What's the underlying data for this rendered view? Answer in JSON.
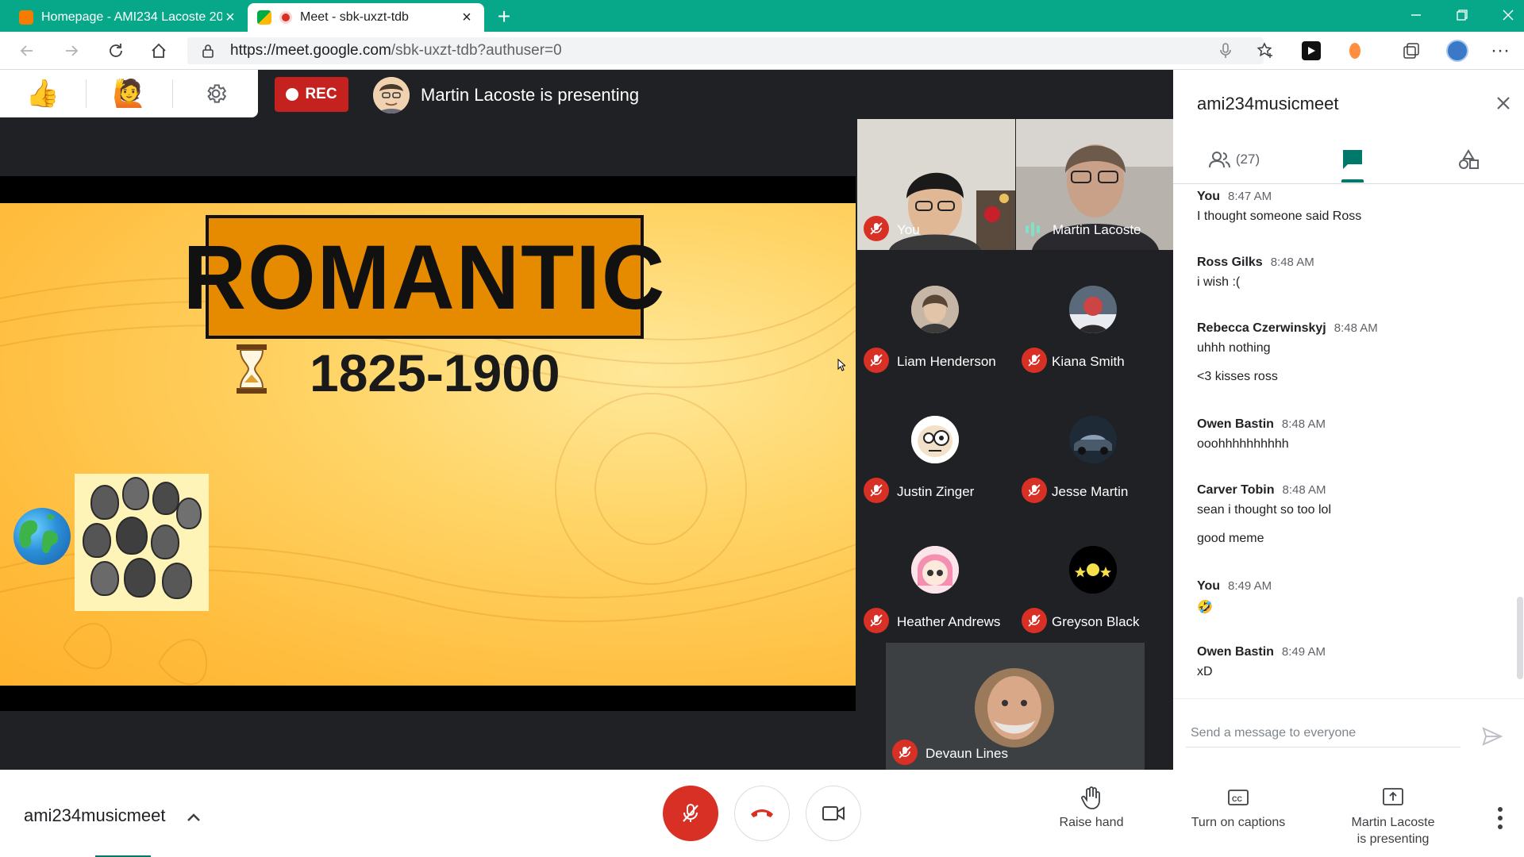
{
  "browser": {
    "tabs": [
      {
        "title": "Homepage - AMI234 Lacoste 20",
        "active": false,
        "favicon_color": "#f57c00"
      },
      {
        "title": "Meet - sbk-uxzt-tdb",
        "active": true,
        "favicon_color": "#00ac47",
        "recording_dot_color": "#d93025"
      }
    ],
    "new_tab_icon": "plus-icon",
    "url_host": "https://meet.google.com",
    "url_path": "/sbk-uxzt-tdb?authuser=0"
  },
  "top_controls": {
    "reactions": [
      "thumbs-up-emoji",
      "raising-hand-emoji",
      "gear-icon"
    ],
    "rec_label": "REC",
    "presenting_text": "Martin Lacoste is presenting"
  },
  "slide": {
    "title": "ROMANTIC",
    "years": "1825-1900",
    "background_color": "#ffc94a",
    "title_box_color": "#e68a00"
  },
  "participants": {
    "featured": [
      {
        "name": "You",
        "mic": "muted"
      },
      {
        "name": "Martin Lacoste",
        "mic": "speaking"
      }
    ],
    "grid": [
      {
        "name": "Liam Henderson",
        "mic": "muted"
      },
      {
        "name": "Kiana Smith",
        "mic": "muted"
      },
      {
        "name": "Justin Zinger",
        "mic": "muted"
      },
      {
        "name": "Jesse Martin",
        "mic": "muted"
      },
      {
        "name": "Heather Andrews",
        "mic": "muted"
      },
      {
        "name": "Greyson Black",
        "mic": "muted"
      }
    ],
    "last": {
      "name": "Devaun Lines",
      "mic": "muted"
    }
  },
  "panel": {
    "title": "ami234musicmeet",
    "people_count": "(27)",
    "active_tab": "chat",
    "accent_color": "#00796b",
    "messages": [
      {
        "sender": "You",
        "time": "8:47 AM",
        "lines": [
          "I thought someone said Ross"
        ]
      },
      {
        "sender": "Ross Gilks",
        "time": "8:48 AM",
        "lines": [
          "i wish :("
        ]
      },
      {
        "sender": "Rebecca Czerwinskyj",
        "time": "8:48 AM",
        "lines": [
          "uhhh nothing",
          "<3 kisses ross"
        ]
      },
      {
        "sender": "Owen Bastin",
        "time": "8:48 AM",
        "lines": [
          "ooohhhhhhhhhh"
        ]
      },
      {
        "sender": "Carver Tobin",
        "time": "8:48 AM",
        "lines": [
          "sean i thought so too lol",
          "good meme"
        ]
      },
      {
        "sender": "You",
        "time": "8:49 AM",
        "lines": [
          "🤣"
        ]
      },
      {
        "sender": "Owen Bastin",
        "time": "8:49 AM",
        "lines": [
          "xD"
        ]
      }
    ],
    "input_placeholder": "Send a message to everyone"
  },
  "bottom": {
    "meeting_code": "ami234musicmeet",
    "mic_button_color": "#d93025",
    "raise_hand": "Raise hand",
    "captions": "Turn on captions",
    "presenting_line1": "Martin Lacoste",
    "presenting_line2": "is presenting"
  }
}
